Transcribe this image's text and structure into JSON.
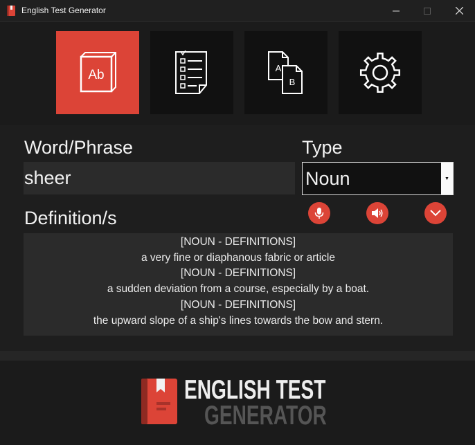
{
  "window": {
    "title": "English Test Generator",
    "minimize_icon": "minimize-icon",
    "maximize_icon": "maximize-icon",
    "close_icon": "close-icon"
  },
  "toolbar": {
    "items": [
      {
        "icon": "dictionary-book-icon",
        "icon_text": "Ab",
        "active": true
      },
      {
        "icon": "checklist-icon",
        "active": false
      },
      {
        "icon": "translate-documents-icon",
        "icon_text_a": "A",
        "icon_text_b": "B",
        "active": false
      },
      {
        "icon": "settings-gear-icon",
        "active": false
      }
    ],
    "accent": "#dc4437"
  },
  "form": {
    "word_label": "Word/Phrase",
    "word_value": "sheer",
    "type_label": "Type",
    "type_value": "Noun",
    "definition_label": "Definition/s",
    "actions": [
      {
        "icon": "microphone-icon"
      },
      {
        "icon": "speaker-icon"
      },
      {
        "icon": "chevron-down-icon"
      }
    ],
    "definitions": [
      "[NOUN - DEFINITIONS]",
      "a very fine or diaphanous fabric or article",
      "[NOUN - DEFINITIONS]",
      "a sudden deviation from a course, especially by a boat.",
      "[NOUN - DEFINITIONS]",
      "the upward slope of a ship's lines towards the bow and stern."
    ]
  },
  "footer": {
    "logo_line1": "ENGLISH TEST",
    "logo_line2": "GENERATOR"
  }
}
